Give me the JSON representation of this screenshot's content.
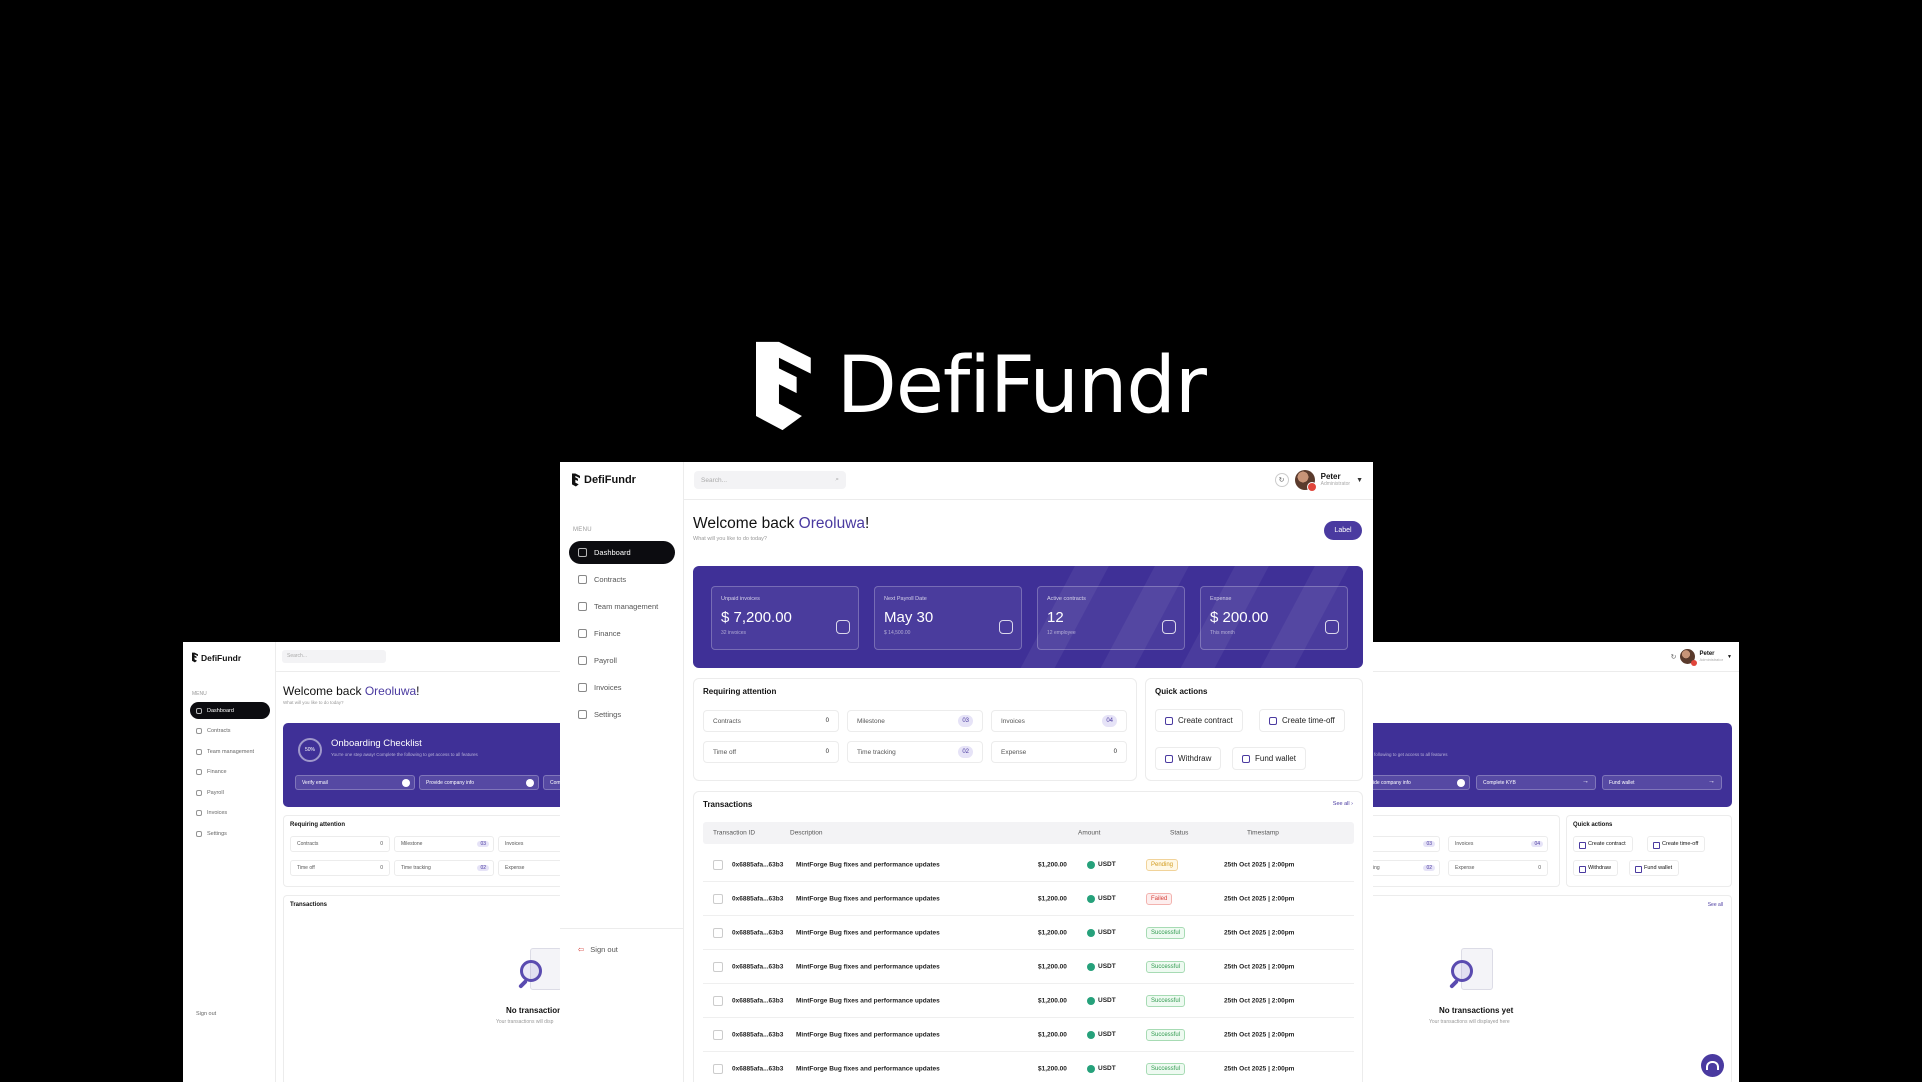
{
  "brand": {
    "name": "DefiFundr",
    "accent": "#4a3aa0",
    "banner_color": "#3f3097"
  },
  "sidebar": {
    "menu_label": "MENU",
    "items": [
      {
        "label": "Dashboard",
        "icon": "home-icon"
      },
      {
        "label": "Contracts",
        "icon": "document-icon"
      },
      {
        "label": "Team management",
        "icon": "users-icon"
      },
      {
        "label": "Finance",
        "icon": "wallet-icon"
      },
      {
        "label": "Payroll",
        "icon": "payroll-icon"
      },
      {
        "label": "Invoices",
        "icon": "invoice-icon"
      },
      {
        "label": "Settings",
        "icon": "gear-icon"
      }
    ],
    "signout": "Sign out"
  },
  "search": {
    "placeholder": "Search..."
  },
  "user": {
    "name": "Peter",
    "role": "Administrator"
  },
  "welcome": {
    "prefix": "Welcome back ",
    "name": "Oreoluwa",
    "suffix": "!",
    "subtitle": "What will you like to do today?"
  },
  "label_button": "Label",
  "stats": [
    {
      "label": "Unpaid invoices",
      "value": "$ 7,200.00",
      "sub": "32 invoices",
      "icon": "invoice-icon"
    },
    {
      "label": "Next Payroll Date",
      "value": "May 30",
      "sub": "$ 14,500.00",
      "icon": "money-icon"
    },
    {
      "label": "Active contracts",
      "value": "12",
      "sub": "12 employee",
      "icon": "contract-icon"
    },
    {
      "label": "Expense",
      "value": "$ 200.00",
      "sub": "This month",
      "icon": "wallet-icon"
    }
  ],
  "attention": {
    "title": "Requiring attention",
    "items": [
      {
        "label": "Contracts",
        "count": "0"
      },
      {
        "label": "Milestone",
        "count": "03"
      },
      {
        "label": "Invoices",
        "count": "04"
      },
      {
        "label": "Time off",
        "count": "0"
      },
      {
        "label": "Time tracking",
        "count": "02"
      },
      {
        "label": "Expense",
        "count": "0"
      }
    ]
  },
  "quick_actions": {
    "title": "Quick actions",
    "items": [
      "Create contract",
      "Create time-off",
      "Withdraw",
      "Fund wallet"
    ]
  },
  "transactions": {
    "title": "Transactions",
    "see_all": "See all",
    "columns": [
      "Transaction ID",
      "Description",
      "Amount",
      "Status",
      "Timestamp"
    ],
    "rows": [
      {
        "id": "0x6885afa...63b3",
        "desc": "MintForge Bug fixes and performance updates",
        "amount": "$1,200.00",
        "currency": "USDT",
        "status": "Pending",
        "ts": "25th Oct 2025 | 2:00pm"
      },
      {
        "id": "0x6885afa...63b3",
        "desc": "MintForge Bug fixes and performance updates",
        "amount": "$1,200.00",
        "currency": "USDT",
        "status": "Failed",
        "ts": "25th Oct 2025 | 2:00pm"
      },
      {
        "id": "0x6885afa...63b3",
        "desc": "MintForge Bug fixes and performance updates",
        "amount": "$1,200.00",
        "currency": "USDT",
        "status": "Successful",
        "ts": "25th Oct 2025 | 2:00pm"
      },
      {
        "id": "0x6885afa...63b3",
        "desc": "MintForge Bug fixes and performance updates",
        "amount": "$1,200.00",
        "currency": "USDT",
        "status": "Successful",
        "ts": "25th Oct 2025 | 2:00pm"
      },
      {
        "id": "0x6885afa...63b3",
        "desc": "MintForge Bug fixes and performance updates",
        "amount": "$1,200.00",
        "currency": "USDT",
        "status": "Successful",
        "ts": "25th Oct 2025 | 2:00pm"
      },
      {
        "id": "0x6885afa...63b3",
        "desc": "MintForge Bug fixes and performance updates",
        "amount": "$1,200.00",
        "currency": "USDT",
        "status": "Successful",
        "ts": "25th Oct 2025 | 2:00pm"
      },
      {
        "id": "0x6885afa...63b3",
        "desc": "MintForge Bug fixes and performance updates",
        "amount": "$1,200.00",
        "currency": "USDT",
        "status": "Successful",
        "ts": "25th Oct 2025 | 2:00pm"
      }
    ]
  },
  "onboarding": {
    "title": "Onboarding Checklist",
    "progress": "50%",
    "subtitle": "You're one step away! Complete the following to get access to all features",
    "steps": [
      "Verify email",
      "Provide company info",
      "Complete KYB",
      "Fund wallet"
    ],
    "step_left_partial": "Com",
    "step_right_partial": "ide company info",
    "subtitle_right_partial": "following to get access to all features"
  },
  "empty_state": {
    "title": "No transactions yet",
    "title_partial": "No transaction",
    "subtitle": "Your transactions will displayed here",
    "subtitle_partial": "Your transactions will disp"
  },
  "partials": {
    "tracking_partial": "ing",
    "see_all_small": "See all"
  }
}
